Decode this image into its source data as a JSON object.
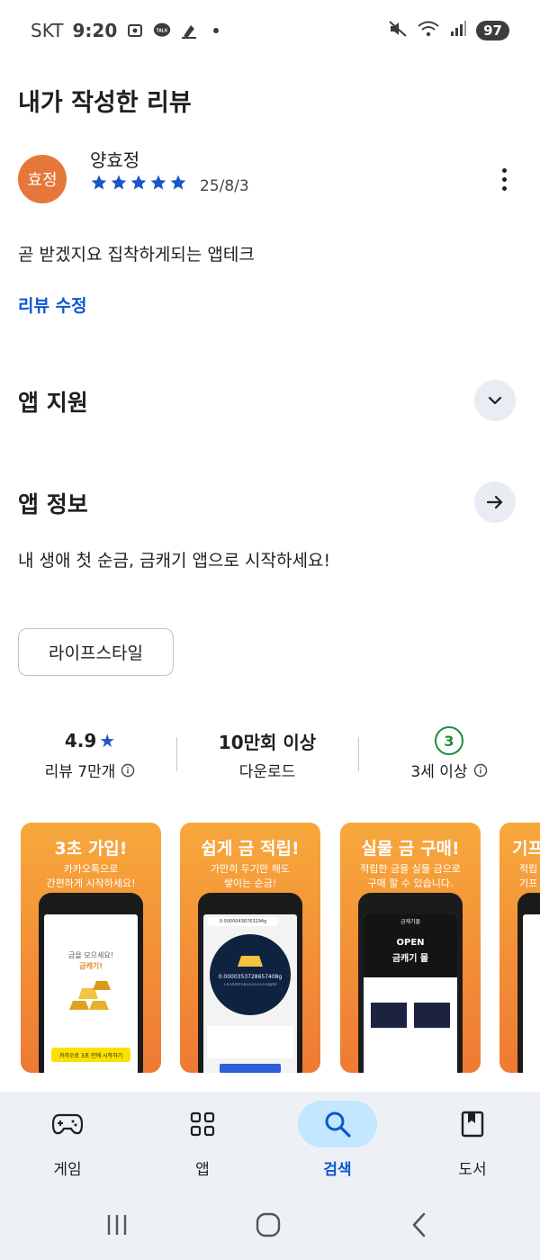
{
  "status_bar": {
    "carrier": "SKT",
    "time": "9:20",
    "talk_badge": "TALK",
    "battery": "97"
  },
  "page_title": "내가 작성한 리뷰",
  "review": {
    "avatar_text": "효정",
    "reviewer": "양효정",
    "rating": 5,
    "date": "25/8/3",
    "text": "곧 받겠지요 집착하게되는 앱테크",
    "edit_label": "리뷰 수정"
  },
  "app_support": {
    "title": "앱 지원"
  },
  "app_info": {
    "title": "앱 정보",
    "description": "내 생애 첫 순금, 금캐기 앱으로 시작하세요!",
    "category": "라이프스타일"
  },
  "stats": {
    "rating_value": "4.9",
    "rating_star": "★",
    "reviews_label": "리뷰 7만개",
    "downloads_value": "10만회 이상",
    "downloads_label": "다운로드",
    "age_value": "3",
    "age_label": "3세 이상"
  },
  "screenshots": [
    {
      "title": "3초 가입!",
      "subtitle": "카카오톡으로\n간편하게 시작하세요!",
      "screen_text": "금을 모으세요!",
      "screen_accent": "금캐기!",
      "screen_button": "카카오로 3초 만에 시작하기"
    },
    {
      "title": "쉽게 금 적립!",
      "subtitle": "가만히 두기만 해도\n쌓이는 순금!",
      "screen_text": "0.0000353728657408g",
      "screen_header": "0.00000438763294g",
      "screen_rate": "+0.000018333333333g/hr"
    },
    {
      "title": "실물 금 구매!",
      "subtitle": "적립한 금을 실물 금으로\n구매 할 수 있습니다.",
      "screen_banner": "OPEN",
      "screen_banner_sub": "금캐기 몰",
      "screen_header": "금캐기몰"
    },
    {
      "title": "기프",
      "subtitle": "적립\n기프"
    }
  ],
  "bottom_nav": [
    {
      "label": "게임",
      "icon": "gamepad-icon",
      "active": false
    },
    {
      "label": "앱",
      "icon": "apps-grid-icon",
      "active": false
    },
    {
      "label": "검색",
      "icon": "search-icon",
      "active": true
    },
    {
      "label": "도서",
      "icon": "book-icon",
      "active": false
    }
  ],
  "colors": {
    "accent_blue": "#0b57d0",
    "star_blue": "#1a56c8",
    "avatar_orange": "#e5773a",
    "age_green": "#1e8e3e",
    "nav_background": "#edf1f6",
    "active_pill": "#c2e7ff"
  }
}
